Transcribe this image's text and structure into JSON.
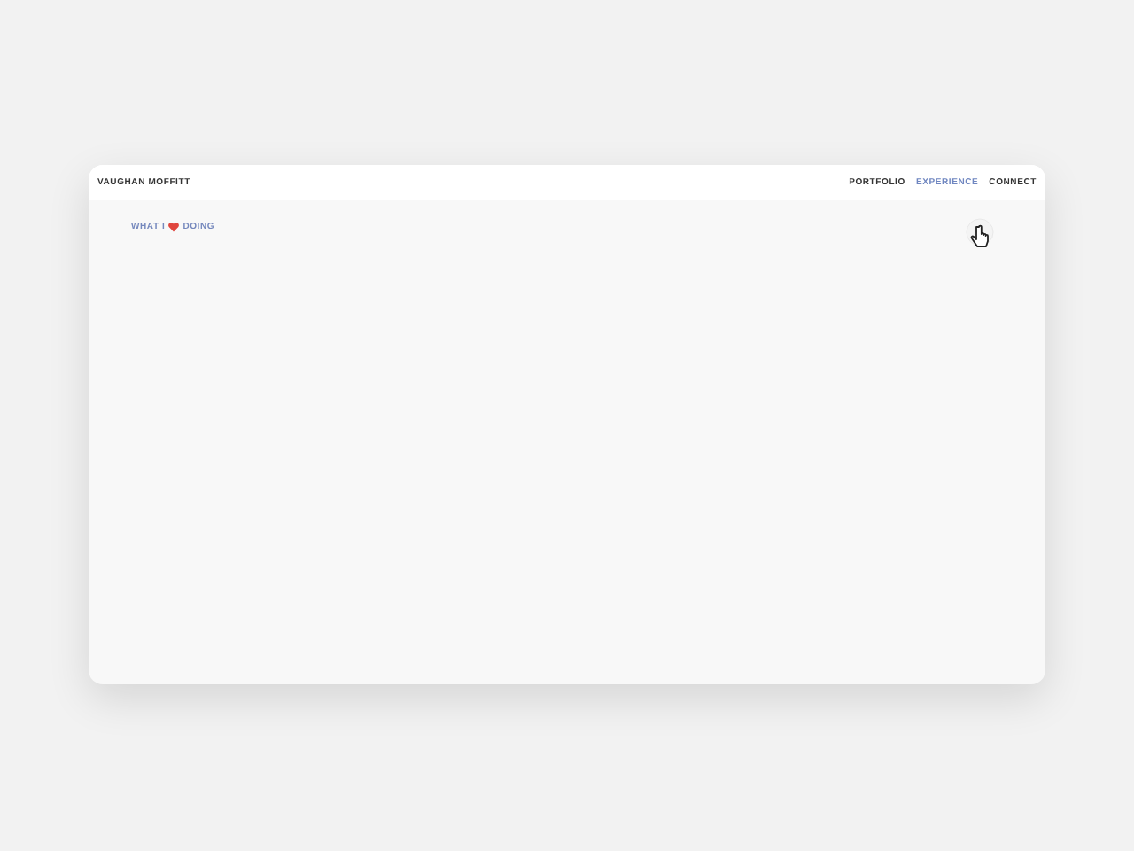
{
  "site": {
    "name": "VAUGHAN MOFFITT"
  },
  "nav": [
    {
      "label": "PORTFOLIO",
      "selected": false
    },
    {
      "label": "EXPERIENCE",
      "selected": true
    },
    {
      "label": "CONNECT",
      "selected": false
    }
  ],
  "heading": {
    "before": "WHAT I",
    "after": "DOING"
  }
}
